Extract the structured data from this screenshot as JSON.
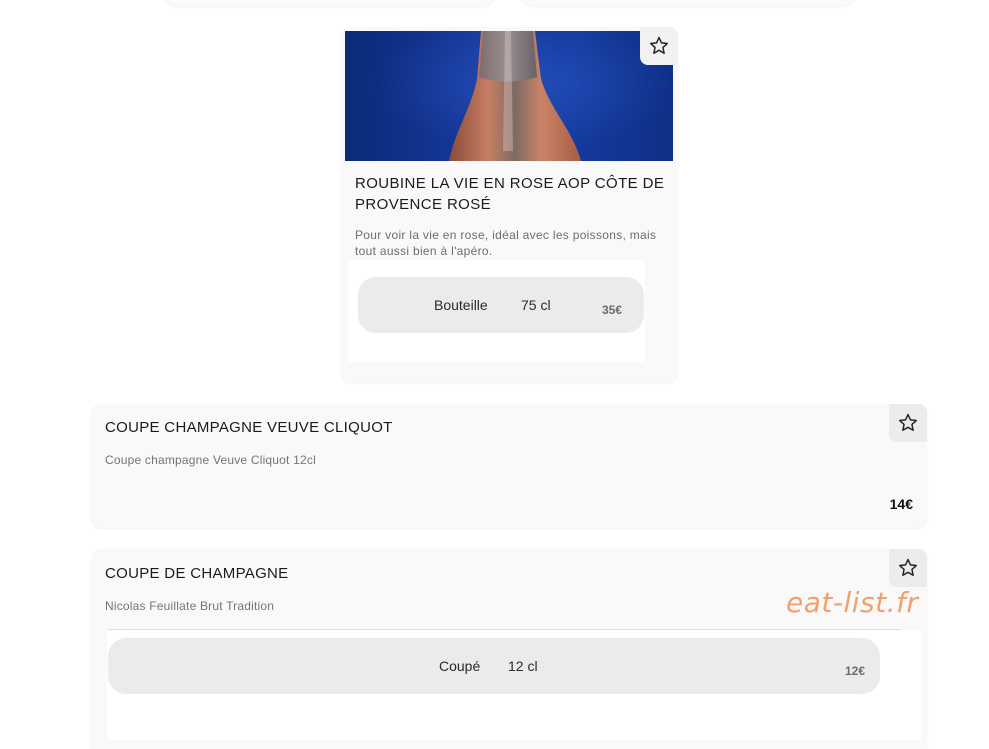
{
  "featured": {
    "title": "ROUBINE LA VIE EN ROSE AOP CÔTE DE PROVENCE ROSÉ",
    "description": "Pour voir la vie en rose, idéal avec les poissons, mais tout aussi bien à l'apéro.",
    "image_icon": "rose-wine-bottle-photo",
    "favorite_icon": "star-outline-icon",
    "option": {
      "format": "Bouteille",
      "volume": "75 cl",
      "price": "35€"
    }
  },
  "items": [
    {
      "name": "COUPE CHAMPAGNE VEUVE CLIQUOT",
      "description": "Coupe champagne Veuve Cliquot 12cl",
      "price": "14€",
      "favorite_icon": "star-outline-icon"
    },
    {
      "name": "COUPE DE CHAMPAGNE",
      "description": "Nicolas Feuillate Brut Tradition",
      "favorite_icon": "star-outline-icon",
      "option": {
        "format": "Coupé",
        "volume": "12 cl",
        "price": "12€"
      }
    }
  ],
  "watermark": "eat-list.fr",
  "colors": {
    "card_bg": "#f9f9f9",
    "pill_bg": "#ebebeb",
    "photo_blue": "#173aa0",
    "watermark": "#f2a06c"
  }
}
